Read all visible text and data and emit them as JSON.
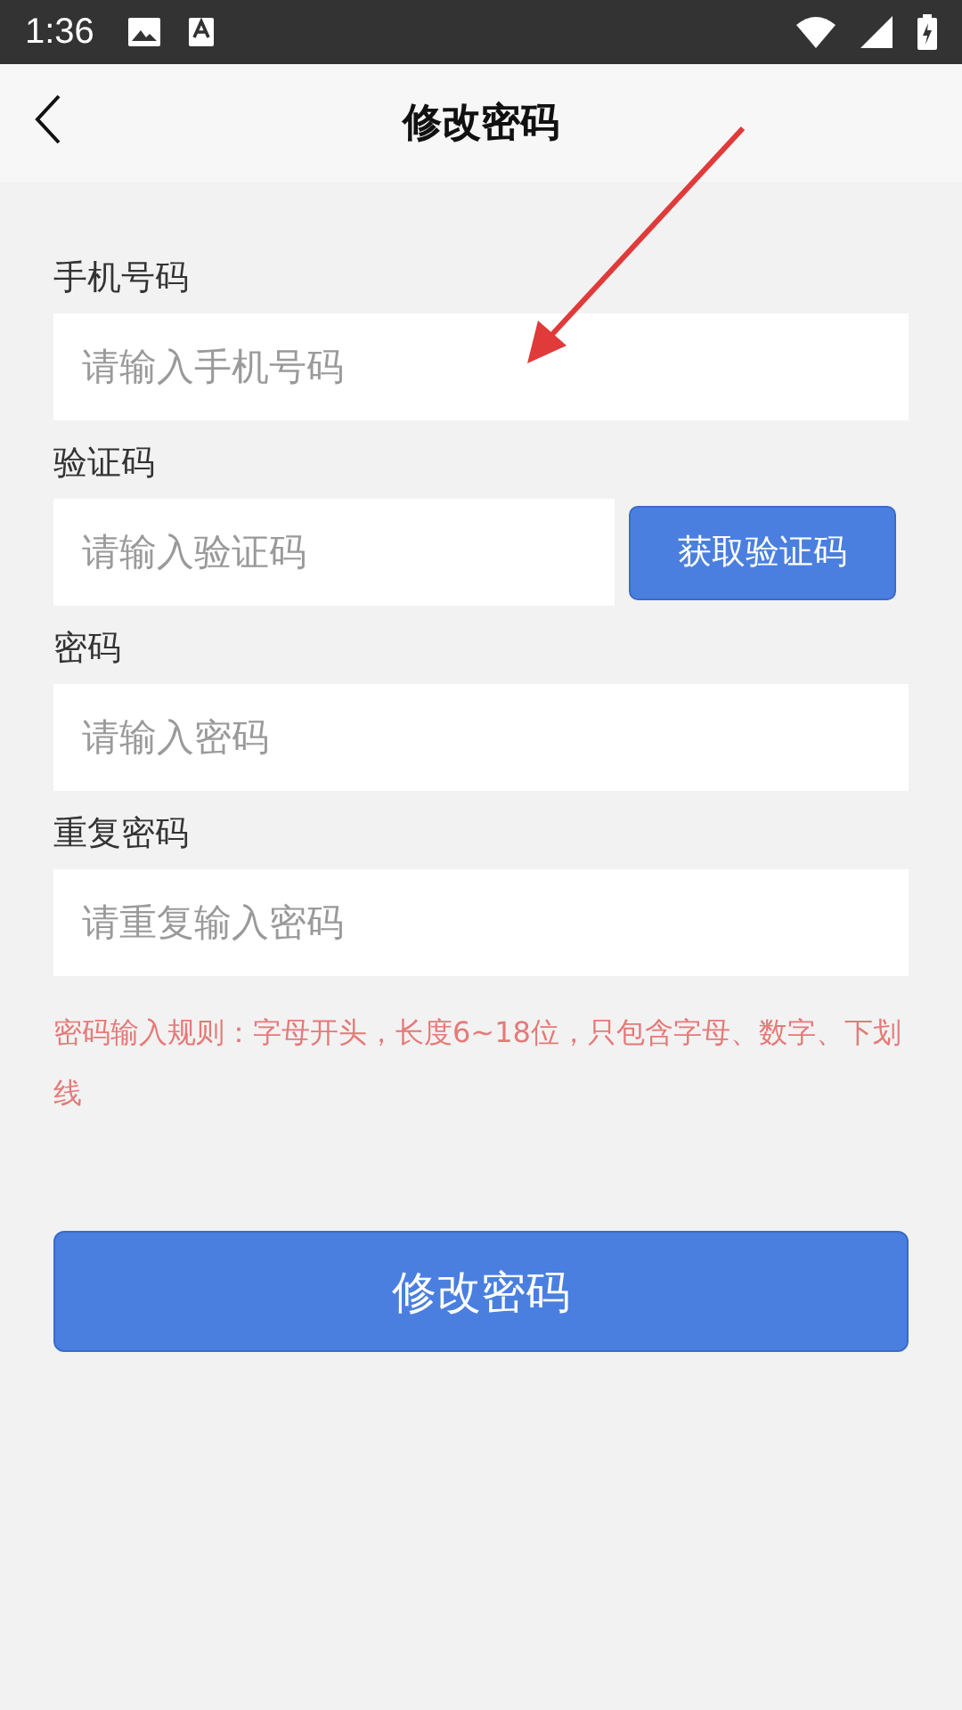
{
  "status_bar": {
    "time": "1:36"
  },
  "header": {
    "title": "修改密码"
  },
  "form": {
    "fields": [
      {
        "label": "手机号码",
        "placeholder": "请输入手机号码",
        "kind": "text"
      },
      {
        "label": "验证码",
        "placeholder": "请输入验证码",
        "kind": "code",
        "button": "获取验证码"
      },
      {
        "label": "密码",
        "placeholder": "请输入密码",
        "kind": "text"
      },
      {
        "label": "重复密码",
        "placeholder": "请重复输入密码",
        "kind": "text"
      }
    ],
    "hint": "密码输入规则：字母开头，长度6~18位，只包含字母、数字、下划线",
    "submit": "修改密码"
  }
}
